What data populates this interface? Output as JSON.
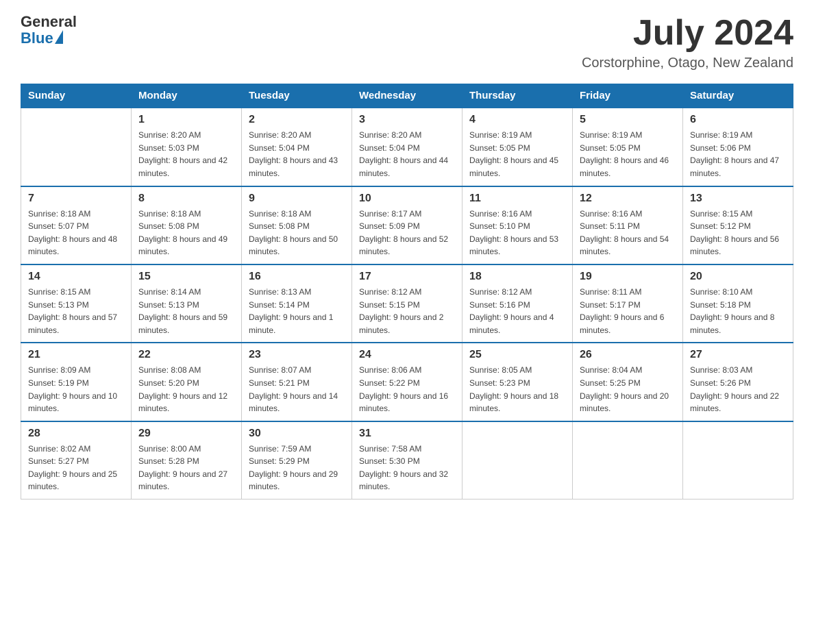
{
  "logo": {
    "text_general": "General",
    "text_blue": "Blue"
  },
  "title": "July 2024",
  "location": "Corstorphine, Otago, New Zealand",
  "days_of_week": [
    "Sunday",
    "Monday",
    "Tuesday",
    "Wednesday",
    "Thursday",
    "Friday",
    "Saturday"
  ],
  "weeks": [
    [
      {
        "day": "",
        "sunrise": "",
        "sunset": "",
        "daylight": ""
      },
      {
        "day": "1",
        "sunrise": "Sunrise: 8:20 AM",
        "sunset": "Sunset: 5:03 PM",
        "daylight": "Daylight: 8 hours and 42 minutes."
      },
      {
        "day": "2",
        "sunrise": "Sunrise: 8:20 AM",
        "sunset": "Sunset: 5:04 PM",
        "daylight": "Daylight: 8 hours and 43 minutes."
      },
      {
        "day": "3",
        "sunrise": "Sunrise: 8:20 AM",
        "sunset": "Sunset: 5:04 PM",
        "daylight": "Daylight: 8 hours and 44 minutes."
      },
      {
        "day": "4",
        "sunrise": "Sunrise: 8:19 AM",
        "sunset": "Sunset: 5:05 PM",
        "daylight": "Daylight: 8 hours and 45 minutes."
      },
      {
        "day": "5",
        "sunrise": "Sunrise: 8:19 AM",
        "sunset": "Sunset: 5:05 PM",
        "daylight": "Daylight: 8 hours and 46 minutes."
      },
      {
        "day": "6",
        "sunrise": "Sunrise: 8:19 AM",
        "sunset": "Sunset: 5:06 PM",
        "daylight": "Daylight: 8 hours and 47 minutes."
      }
    ],
    [
      {
        "day": "7",
        "sunrise": "Sunrise: 8:18 AM",
        "sunset": "Sunset: 5:07 PM",
        "daylight": "Daylight: 8 hours and 48 minutes."
      },
      {
        "day": "8",
        "sunrise": "Sunrise: 8:18 AM",
        "sunset": "Sunset: 5:08 PM",
        "daylight": "Daylight: 8 hours and 49 minutes."
      },
      {
        "day": "9",
        "sunrise": "Sunrise: 8:18 AM",
        "sunset": "Sunset: 5:08 PM",
        "daylight": "Daylight: 8 hours and 50 minutes."
      },
      {
        "day": "10",
        "sunrise": "Sunrise: 8:17 AM",
        "sunset": "Sunset: 5:09 PM",
        "daylight": "Daylight: 8 hours and 52 minutes."
      },
      {
        "day": "11",
        "sunrise": "Sunrise: 8:16 AM",
        "sunset": "Sunset: 5:10 PM",
        "daylight": "Daylight: 8 hours and 53 minutes."
      },
      {
        "day": "12",
        "sunrise": "Sunrise: 8:16 AM",
        "sunset": "Sunset: 5:11 PM",
        "daylight": "Daylight: 8 hours and 54 minutes."
      },
      {
        "day": "13",
        "sunrise": "Sunrise: 8:15 AM",
        "sunset": "Sunset: 5:12 PM",
        "daylight": "Daylight: 8 hours and 56 minutes."
      }
    ],
    [
      {
        "day": "14",
        "sunrise": "Sunrise: 8:15 AM",
        "sunset": "Sunset: 5:13 PM",
        "daylight": "Daylight: 8 hours and 57 minutes."
      },
      {
        "day": "15",
        "sunrise": "Sunrise: 8:14 AM",
        "sunset": "Sunset: 5:13 PM",
        "daylight": "Daylight: 8 hours and 59 minutes."
      },
      {
        "day": "16",
        "sunrise": "Sunrise: 8:13 AM",
        "sunset": "Sunset: 5:14 PM",
        "daylight": "Daylight: 9 hours and 1 minute."
      },
      {
        "day": "17",
        "sunrise": "Sunrise: 8:12 AM",
        "sunset": "Sunset: 5:15 PM",
        "daylight": "Daylight: 9 hours and 2 minutes."
      },
      {
        "day": "18",
        "sunrise": "Sunrise: 8:12 AM",
        "sunset": "Sunset: 5:16 PM",
        "daylight": "Daylight: 9 hours and 4 minutes."
      },
      {
        "day": "19",
        "sunrise": "Sunrise: 8:11 AM",
        "sunset": "Sunset: 5:17 PM",
        "daylight": "Daylight: 9 hours and 6 minutes."
      },
      {
        "day": "20",
        "sunrise": "Sunrise: 8:10 AM",
        "sunset": "Sunset: 5:18 PM",
        "daylight": "Daylight: 9 hours and 8 minutes."
      }
    ],
    [
      {
        "day": "21",
        "sunrise": "Sunrise: 8:09 AM",
        "sunset": "Sunset: 5:19 PM",
        "daylight": "Daylight: 9 hours and 10 minutes."
      },
      {
        "day": "22",
        "sunrise": "Sunrise: 8:08 AM",
        "sunset": "Sunset: 5:20 PM",
        "daylight": "Daylight: 9 hours and 12 minutes."
      },
      {
        "day": "23",
        "sunrise": "Sunrise: 8:07 AM",
        "sunset": "Sunset: 5:21 PM",
        "daylight": "Daylight: 9 hours and 14 minutes."
      },
      {
        "day": "24",
        "sunrise": "Sunrise: 8:06 AM",
        "sunset": "Sunset: 5:22 PM",
        "daylight": "Daylight: 9 hours and 16 minutes."
      },
      {
        "day": "25",
        "sunrise": "Sunrise: 8:05 AM",
        "sunset": "Sunset: 5:23 PM",
        "daylight": "Daylight: 9 hours and 18 minutes."
      },
      {
        "day": "26",
        "sunrise": "Sunrise: 8:04 AM",
        "sunset": "Sunset: 5:25 PM",
        "daylight": "Daylight: 9 hours and 20 minutes."
      },
      {
        "day": "27",
        "sunrise": "Sunrise: 8:03 AM",
        "sunset": "Sunset: 5:26 PM",
        "daylight": "Daylight: 9 hours and 22 minutes."
      }
    ],
    [
      {
        "day": "28",
        "sunrise": "Sunrise: 8:02 AM",
        "sunset": "Sunset: 5:27 PM",
        "daylight": "Daylight: 9 hours and 25 minutes."
      },
      {
        "day": "29",
        "sunrise": "Sunrise: 8:00 AM",
        "sunset": "Sunset: 5:28 PM",
        "daylight": "Daylight: 9 hours and 27 minutes."
      },
      {
        "day": "30",
        "sunrise": "Sunrise: 7:59 AM",
        "sunset": "Sunset: 5:29 PM",
        "daylight": "Daylight: 9 hours and 29 minutes."
      },
      {
        "day": "31",
        "sunrise": "Sunrise: 7:58 AM",
        "sunset": "Sunset: 5:30 PM",
        "daylight": "Daylight: 9 hours and 32 minutes."
      },
      {
        "day": "",
        "sunrise": "",
        "sunset": "",
        "daylight": ""
      },
      {
        "day": "",
        "sunrise": "",
        "sunset": "",
        "daylight": ""
      },
      {
        "day": "",
        "sunrise": "",
        "sunset": "",
        "daylight": ""
      }
    ]
  ]
}
